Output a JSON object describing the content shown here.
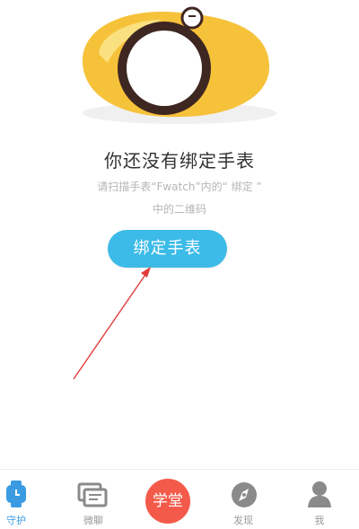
{
  "empty_state": {
    "title": "你还没有绑定手表",
    "hint_line1": "请扫描手表“Fwatch”内的“ 绑定 ”",
    "hint_line2": "中的二维码",
    "bind_button": "绑定手表"
  },
  "tabbar": {
    "items": [
      {
        "label": "守护",
        "icon": "watch-icon",
        "active": true
      },
      {
        "label": "微聊",
        "icon": "chat-icon",
        "active": false
      },
      {
        "label": "学堂",
        "icon": "school-badge",
        "active": false
      },
      {
        "label": "发现",
        "icon": "compass-icon",
        "active": false
      },
      {
        "label": "我",
        "icon": "person-icon",
        "active": false
      }
    ]
  },
  "colors": {
    "accent": "#3cbbe8",
    "active_tab": "#3a9be2",
    "school_badge": "#f35a4a",
    "annotation_arrow": "#e23b3b",
    "illustration_yellow": "#f6c23a",
    "watch_ring": "#3e2621"
  }
}
